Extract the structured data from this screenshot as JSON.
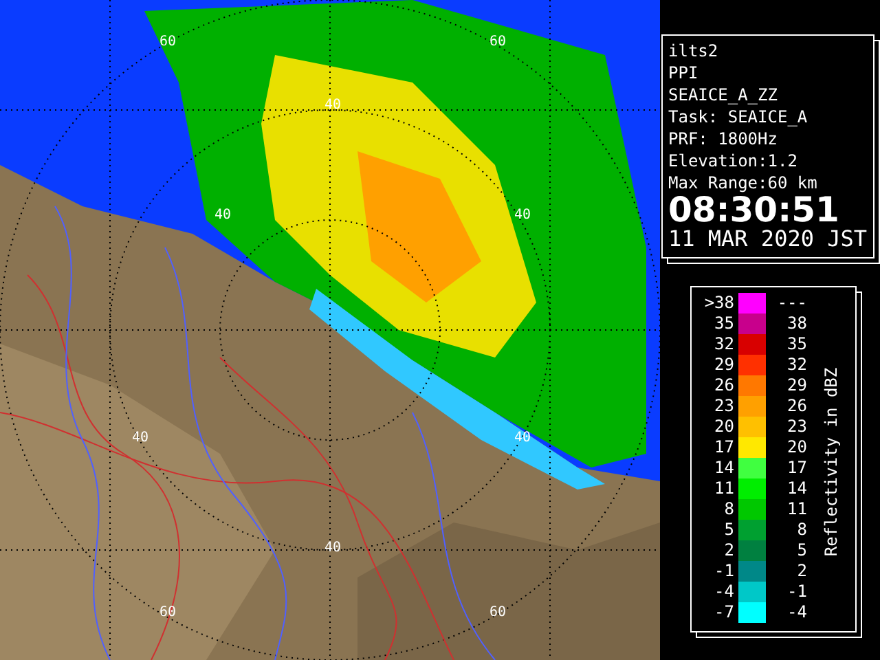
{
  "radar_map": {
    "range_labels": [
      "60",
      "60",
      "40",
      "40",
      "40",
      "40",
      "40",
      "40",
      "60",
      "60"
    ]
  },
  "info_panel": {
    "lines": [
      "ilts2",
      "PPI",
      "SEAICE_A_ZZ",
      "Task: SEAICE_A",
      "PRF: 1800Hz",
      "Elevation:1.2",
      "Max Range:60 km"
    ],
    "time": "08:30:51",
    "date": "11 MAR 2020 JST"
  },
  "legend": {
    "title": "Reflectivity in dBZ",
    "bands": [
      {
        "low": ">38",
        "high": "---",
        "color": "#ff00ff"
      },
      {
        "low": "35",
        "high": "38",
        "color": "#c8008c"
      },
      {
        "low": "32",
        "high": "35",
        "color": "#d80000"
      },
      {
        "low": "29",
        "high": "32",
        "color": "#ff3000"
      },
      {
        "low": "26",
        "high": "29",
        "color": "#ff7800"
      },
      {
        "low": "23",
        "high": "26",
        "color": "#ffa000"
      },
      {
        "low": "20",
        "high": "23",
        "color": "#ffc000"
      },
      {
        "low": "17",
        "high": "20",
        "color": "#ffe800"
      },
      {
        "low": "14",
        "high": "17",
        "color": "#40ff40"
      },
      {
        "low": "11",
        "high": "14",
        "color": "#00ee00"
      },
      {
        "low": "8",
        "high": "11",
        "color": "#00c800"
      },
      {
        "low": "5",
        "high": "8",
        "color": "#00a030"
      },
      {
        "low": "2",
        "high": "5",
        "color": "#008040"
      },
      {
        "low": "-1",
        "high": "2",
        "color": "#008888"
      },
      {
        "low": "-4",
        "high": "-1",
        "color": "#00c8c8"
      },
      {
        "low": "-7",
        "high": "-4",
        "color": "#00ffff"
      }
    ]
  }
}
